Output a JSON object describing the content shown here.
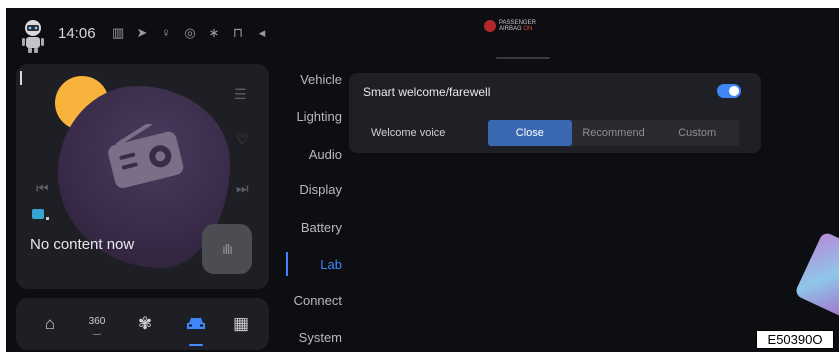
{
  "status_bar": {
    "time": "14:06",
    "airbag": {
      "line1": "PASSENGER",
      "line2": "AIRBAG",
      "state": "ON"
    },
    "icons": [
      "signal-icon",
      "location-icon",
      "microphone-icon",
      "wifi-icon",
      "bluetooth-icon",
      "lock-icon",
      "mute-icon"
    ]
  },
  "media": {
    "title": "No content now",
    "icons": [
      "playlist-icon",
      "heart-icon",
      "previous-icon",
      "next-icon",
      "voice-bars-icon",
      "source-icon",
      "radio-icon"
    ]
  },
  "dock": {
    "items": [
      {
        "name": "home",
        "label": ""
      },
      {
        "name": "360-camera",
        "label": "360"
      },
      {
        "name": "fan",
        "label": ""
      },
      {
        "name": "car",
        "label": ""
      },
      {
        "name": "apps",
        "label": ""
      }
    ],
    "active": "car"
  },
  "settings_nav": {
    "items": [
      {
        "label": "Vehicle"
      },
      {
        "label": "Lighting"
      },
      {
        "label": "Audio"
      },
      {
        "label": "Display"
      },
      {
        "label": "Battery"
      },
      {
        "label": "Lab"
      },
      {
        "label": "Connect"
      },
      {
        "label": "System"
      }
    ],
    "active": "Lab"
  },
  "lab": {
    "smart_welcome_label": "Smart welcome/farewell",
    "smart_welcome_enabled": true,
    "welcome_voice_label": "Welcome voice",
    "welcome_voice_options": [
      "Close",
      "Recommend",
      "Custom"
    ],
    "welcome_voice_selected": "Close"
  },
  "figure_code": "E50390O",
  "colors": {
    "accent": "#3f86f8",
    "background": "#0d0e12",
    "card": "#1e1f24",
    "sun": "#f7b33c",
    "airbag_red": "#b3262a"
  }
}
